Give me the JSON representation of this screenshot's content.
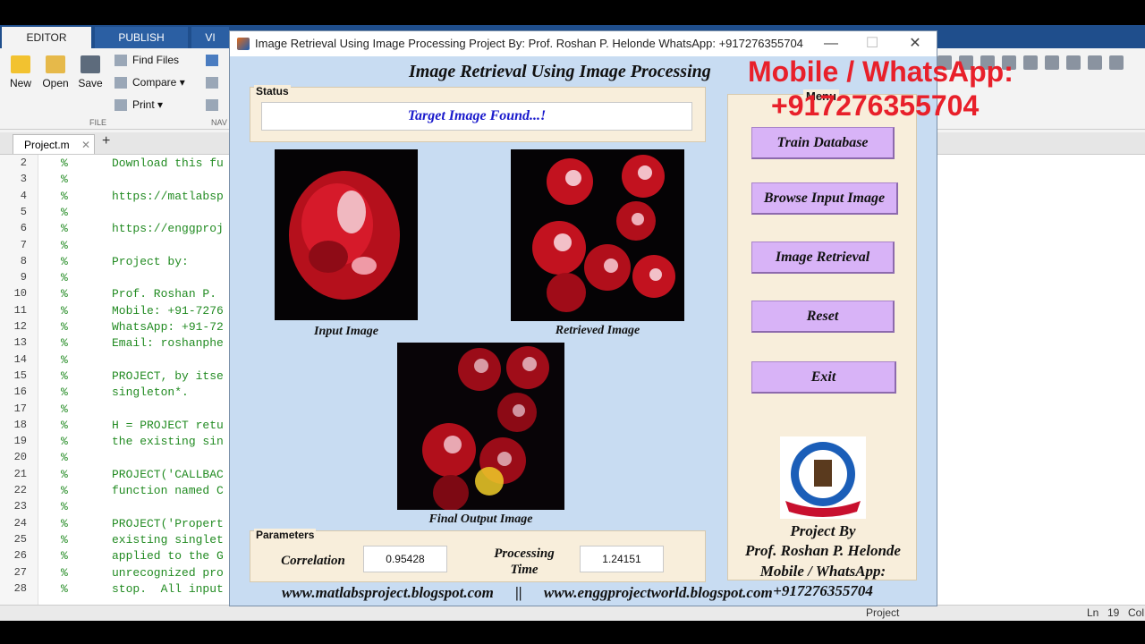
{
  "matlab": {
    "tabs": [
      "EDITOR",
      "PUBLISH",
      "VI"
    ],
    "ribbon": {
      "new": "New",
      "open": "Open",
      "save": "Save",
      "find_files": "Find Files",
      "compare": "Compare",
      "print": "Print",
      "file_section": "FILE",
      "nav_section": "NAV"
    },
    "file_tab": "Project.m",
    "code_lines": [
      {
        "n": "2",
        "text": "Download this fu"
      },
      {
        "n": "3",
        "text": ""
      },
      {
        "n": "4",
        "text": "https://matlabsp"
      },
      {
        "n": "5",
        "text": ""
      },
      {
        "n": "6",
        "text": "https://enggproj"
      },
      {
        "n": "7",
        "text": ""
      },
      {
        "n": "8",
        "text": "Project by:"
      },
      {
        "n": "9",
        "text": ""
      },
      {
        "n": "10",
        "text": "Prof. Roshan P."
      },
      {
        "n": "11",
        "text": "Mobile: +91-7276"
      },
      {
        "n": "12",
        "text": "WhatsApp: +91-72"
      },
      {
        "n": "13",
        "text": "Email: roshanphe"
      },
      {
        "n": "14",
        "text": ""
      },
      {
        "n": "15",
        "text": "PROJECT, by itse"
      },
      {
        "n": "16",
        "text": "singleton*."
      },
      {
        "n": "17",
        "text": ""
      },
      {
        "n": "18",
        "text": "H = PROJECT retu"
      },
      {
        "n": "19",
        "text": "the existing sin"
      },
      {
        "n": "20",
        "text": ""
      },
      {
        "n": "21",
        "text": "PROJECT('CALLBAC"
      },
      {
        "n": "22",
        "text": "function named C"
      },
      {
        "n": "23",
        "text": ""
      },
      {
        "n": "24",
        "text": "PROJECT('Propert"
      },
      {
        "n": "25",
        "text": "existing singlet"
      },
      {
        "n": "26",
        "text": "applied to the G"
      },
      {
        "n": "27",
        "text": "unrecognized pro"
      },
      {
        "n": "28",
        "text": "stop.  All input"
      }
    ],
    "comment_char": "%",
    "status_project": "Project",
    "status_ln": "Ln",
    "status_ln_val": "19",
    "status_col": "Col"
  },
  "window": {
    "title": "Image Retrieval Using Image Processing    Project By: Prof. Roshan P. Helonde       WhatsApp: +917276355704",
    "minimize": "—",
    "maximize": "☐",
    "close": "✕"
  },
  "gui": {
    "heading": "Image Retrieval Using Image Processing",
    "status_panel_title": "Status",
    "status_text": "Target Image Found...!",
    "input_caption": "Input Image",
    "retrieved_caption": "Retrieved Image",
    "final_caption": "Final Output Image",
    "parameters_title": "Parameters",
    "correlation_label": "Correlation",
    "correlation_value": "0.95428",
    "processing_label_1": "Processing",
    "processing_label_2": "Time",
    "processing_value": "1.24151",
    "menu_title": "Menu",
    "buttons": {
      "train": "Train Database",
      "browse": "Browse Input Image",
      "retrieval": "Image Retrieval",
      "reset": "Reset",
      "exit": "Exit"
    },
    "credits": {
      "line1": "Project By",
      "line2": "Prof. Roshan P. Helonde",
      "line3": "Mobile / WhatsApp:",
      "line4": "+917276355704"
    },
    "footer": {
      "link1": "www.matlabsproject.blogspot.com",
      "sep": "||",
      "link2": "www.enggprojectworld.blogspot.com"
    }
  },
  "overlay": {
    "line1": "Mobile / WhatsApp:",
    "line2": "+917276355704",
    "color": "#e8202a"
  }
}
